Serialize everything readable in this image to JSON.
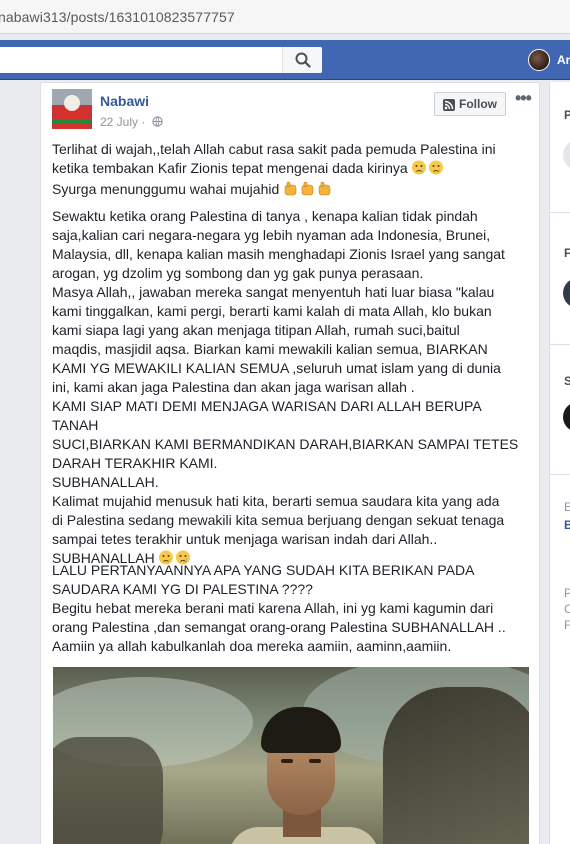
{
  "browser": {
    "url": "nabawi313/posts/1631010823577757"
  },
  "topbar": {
    "search_placeholder": "",
    "user_name": "Ar"
  },
  "post": {
    "author": "Nabawi",
    "date": "22 July",
    "meta_separator": "·",
    "follow_label": "Follow",
    "more_label": "•••",
    "paragraphs": [
      "Terlihat di wajah,,telah Allah cabut rasa sakit pada pemuda Palestina ini\nketika tembakan Kafir Zionis tepat mengenai dada kirinya",
      "Syurga menunggumu wahai mujahid",
      "Sewaktu ketika orang Palestina di tanya , kenapa kalian tidak pindah\nsaja,kalian cari negara-negara yg lebih nyaman ada Indonesia, Brunei,\nMalaysia, dll, kenapa kalian masih menghadapi Zionis Israel yang sangat\narogan, yg dzolim yg sombong dan yg gak punya perasaan.\nMasya Allah,, jawaban mereka sangat menyentuh hati luar biasa \"kalau\nkami tinggalkan, kami pergi, berarti kami kalah di mata Allah, klo bukan\nkami siapa lagi yang akan menjaga titipan Allah, rumah suci,baitul\nmaqdis, masjidil aqsa. Biarkan kami mewakili kalian semua, BIARKAN\nKAMI YG MEWAKILI KALIAN SEMUA ,seluruh umat islam yang di dunia\nini, kami akan jaga Palestina dan akan jaga warisan allah .\nKAMI SIAP MATI DEMI MENJAGA WARISAN DARI ALLAH BERUPA TANAH\nSUCI,BIARKAN KAMI BERMANDIKAN DARAH,BIARKAN SAMPAI TETES\nDARAH TERAKHIR KAMI.\nSUBHANALLAH.\nKalimat mujahid menusuk hati kita, berarti semua saudara kita yang ada\ndi Palestina sedang mewakili kita semua berjuang dengan sekuat tenaga\nsampai tetes terakhir untuk menjaga warisan indah dari Allah..",
      "SUBHANALLAH",
      "LALU PERTANYAANNYA APA YANG SUDAH KITA BERIKAN PADA\nSAUDARA KAMI YG DI PALESTINA ????\nBegitu hebat mereka berani mati karena Allah, ini yg kami kagumin dari\norang Palestina ,dan semangat orang-orang Palestina SUBHANALLAH ..\nAamiin ya allah kabulkanlah doa mereka aamiin, aaminn,aamiin."
    ]
  },
  "sidebar": {
    "letters": [
      "P",
      "F",
      "S",
      "E",
      "B",
      "P",
      "C",
      "F"
    ]
  },
  "colors": {
    "fb_blue": "#4267b2",
    "link": "#365899",
    "bg": "#e9ebee"
  }
}
